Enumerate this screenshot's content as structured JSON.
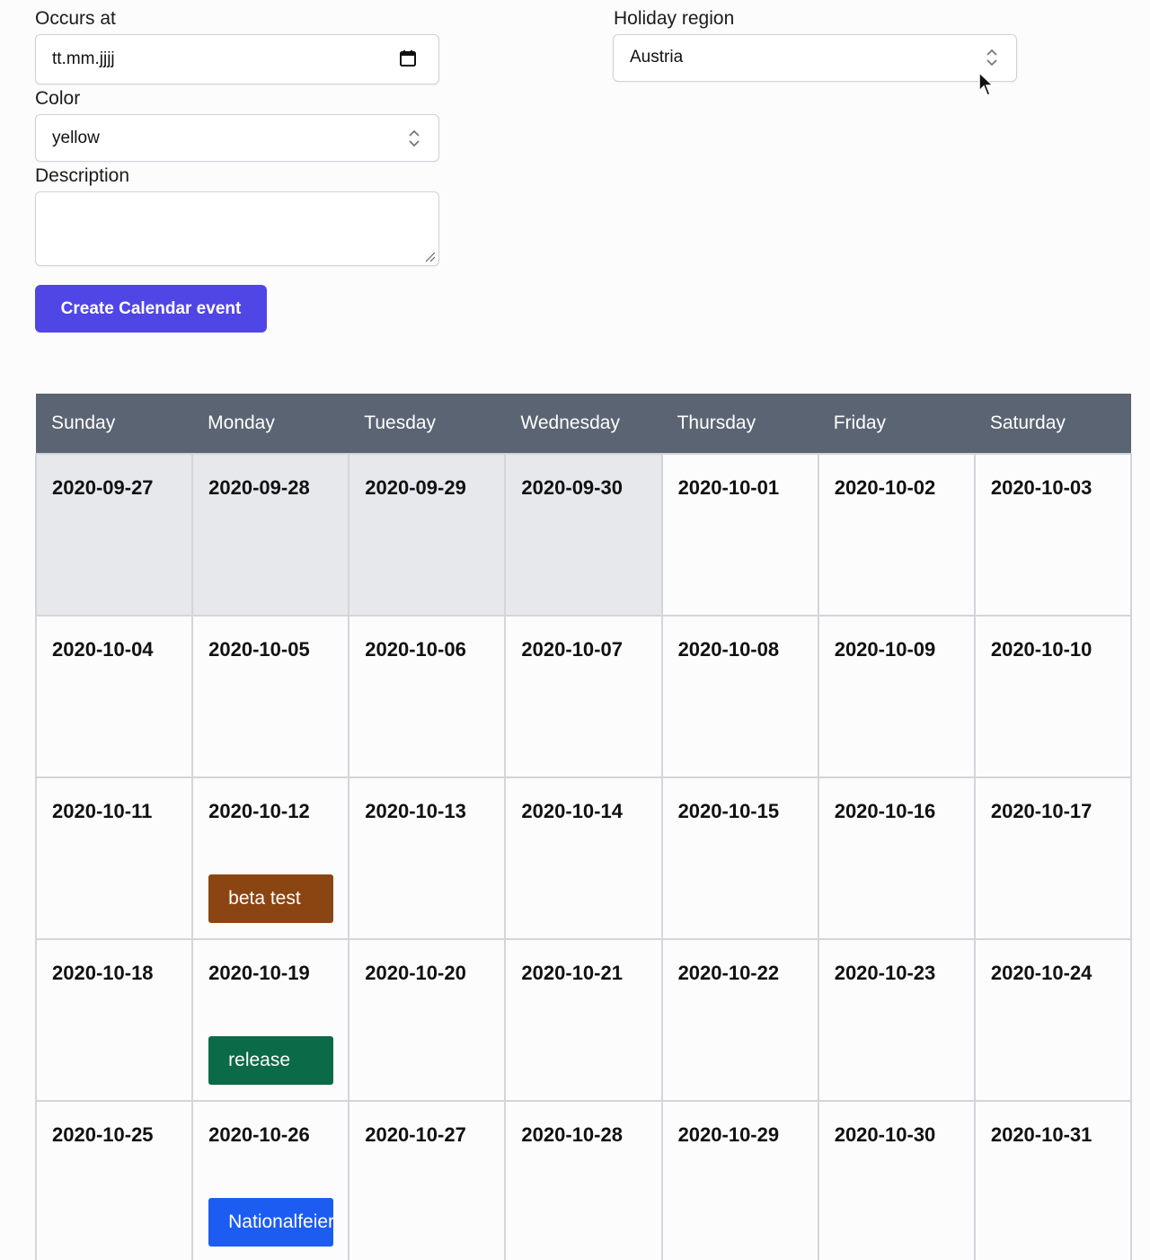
{
  "form": {
    "occurs_at": {
      "label": "Occurs at",
      "value": "tt.mm.jjjj"
    },
    "color": {
      "label": "Color",
      "value": "yellow"
    },
    "description": {
      "label": "Description",
      "value": ""
    },
    "holiday_region": {
      "label": "Holiday region",
      "value": "Austria"
    },
    "submit_label": "Create Calendar event"
  },
  "calendar": {
    "weekdays": [
      "Sunday",
      "Monday",
      "Tuesday",
      "Wednesday",
      "Thursday",
      "Friday",
      "Saturday"
    ],
    "weeks": [
      [
        {
          "date": "2020-09-27",
          "other_month": true
        },
        {
          "date": "2020-09-28",
          "other_month": true
        },
        {
          "date": "2020-09-29",
          "other_month": true
        },
        {
          "date": "2020-09-30",
          "other_month": true
        },
        {
          "date": "2020-10-01"
        },
        {
          "date": "2020-10-02"
        },
        {
          "date": "2020-10-03"
        }
      ],
      [
        {
          "date": "2020-10-04"
        },
        {
          "date": "2020-10-05"
        },
        {
          "date": "2020-10-06"
        },
        {
          "date": "2020-10-07"
        },
        {
          "date": "2020-10-08"
        },
        {
          "date": "2020-10-09"
        },
        {
          "date": "2020-10-10"
        }
      ],
      [
        {
          "date": "2020-10-11"
        },
        {
          "date": "2020-10-12",
          "event": {
            "label": "beta test",
            "color": "#8b4513"
          }
        },
        {
          "date": "2020-10-13"
        },
        {
          "date": "2020-10-14"
        },
        {
          "date": "2020-10-15"
        },
        {
          "date": "2020-10-16"
        },
        {
          "date": "2020-10-17"
        }
      ],
      [
        {
          "date": "2020-10-18"
        },
        {
          "date": "2020-10-19",
          "event": {
            "label": "release",
            "color": "#0b6a48"
          }
        },
        {
          "date": "2020-10-20"
        },
        {
          "date": "2020-10-21"
        },
        {
          "date": "2020-10-22"
        },
        {
          "date": "2020-10-23"
        },
        {
          "date": "2020-10-24"
        }
      ],
      [
        {
          "date": "2020-10-25"
        },
        {
          "date": "2020-10-26",
          "event": {
            "label": "Nationalfeiertag",
            "color": "#1d5cf0"
          }
        },
        {
          "date": "2020-10-27"
        },
        {
          "date": "2020-10-28"
        },
        {
          "date": "2020-10-29"
        },
        {
          "date": "2020-10-30"
        },
        {
          "date": "2020-10-31"
        }
      ]
    ]
  }
}
